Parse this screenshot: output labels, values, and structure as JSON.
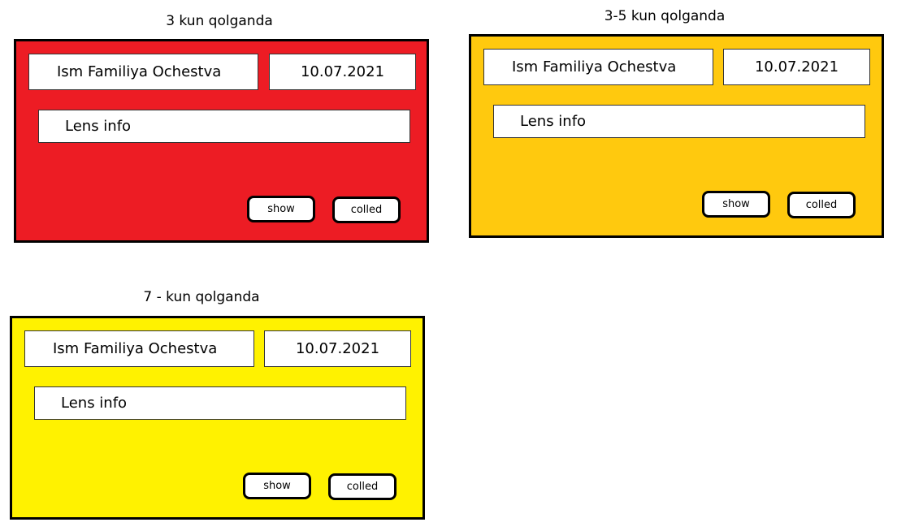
{
  "cards": [
    {
      "title": "3 kun qolganda",
      "color": "#ed1c24",
      "name": "Ism Familiya Ochestva",
      "date": "10.07.2021",
      "info": "Lens info",
      "show_label": "show",
      "called_label": "colled"
    },
    {
      "title": "3-5 kun qolganda",
      "color": "#ffc90e",
      "name": "Ism Familiya Ochestva",
      "date": "10.07.2021",
      "info": "Lens info",
      "show_label": "show",
      "called_label": "colled"
    },
    {
      "title": "7 - kun qolganda",
      "color": "#fff200",
      "name": "Ism Familiya Ochestva",
      "date": "10.07.2021",
      "info": "Lens info",
      "show_label": "show",
      "called_label": "colled"
    }
  ]
}
